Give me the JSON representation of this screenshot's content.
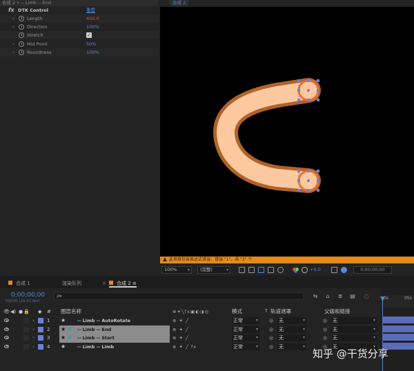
{
  "effects": {
    "header": "合成 2 • -- Limb -- End",
    "fx_label": "fx",
    "effect_name": "DTK Control",
    "reset": "重置",
    "params": [
      {
        "name": "Length",
        "value": "400.0",
        "expandable": true,
        "value_color": "#d84a3a"
      },
      {
        "name": "Direction",
        "value": "100%",
        "expandable": true,
        "value_color": "#4a8cdb"
      },
      {
        "name": "Stretch",
        "value": "✓",
        "expandable": false,
        "is_checkbox": true
      },
      {
        "name": "Mid Point",
        "value": "50%",
        "expandable": true,
        "value_color": "#4a8cdb"
      },
      {
        "name": "Roundness",
        "value": "100%",
        "expandable": true,
        "value_color": "#4a8cdb"
      }
    ]
  },
  "viewer": {
    "tab": "合成 2",
    "warning": "此项目包含表达式错误：错误 \"1\"，共 \"3\" 个",
    "zoom": "100%",
    "resolution": "(完整)",
    "exposure": "+0.0",
    "timecode": "0;00;00;00",
    "colors": {
      "limb_outer": "#b0622a",
      "limb_inner": "#fbc8a0",
      "handle_ring": "#e8742a",
      "handle_point": "#6f7fe0"
    }
  },
  "timeline": {
    "tabs": [
      {
        "label": "合成 1",
        "active": false,
        "closable": false
      },
      {
        "label": "渲染队列",
        "active": false,
        "closable": false
      },
      {
        "label": "合成 2",
        "active": true,
        "closable": true
      }
    ],
    "timecode": "0;00;00;00",
    "fps": "00000 (29.97 fps)",
    "search_placeholder": "ρ▸",
    "columns": {
      "name": "图层名称",
      "mode": "模式",
      "t": "T",
      "track_matte": "轨道遮罩",
      "parent": "父级和链接"
    },
    "layers": [
      {
        "num": "1",
        "name": "-- Limb -- AutoRotate",
        "selected": false,
        "mode": "正常",
        "track": "无",
        "parent": "无",
        "has_fx": false
      },
      {
        "num": "2",
        "name": "-- Limb -- End",
        "selected": true,
        "mode": "正常",
        "track": "无",
        "parent": "无",
        "has_fx": false
      },
      {
        "num": "3",
        "name": "-- Limb -- Start",
        "selected": true,
        "mode": "正常",
        "track": "无",
        "parent": "无",
        "has_fx": false
      },
      {
        "num": "4",
        "name": "-- Limb -- Limb",
        "selected": false,
        "mode": "正常",
        "track": "无",
        "parent": "无",
        "has_fx": true
      }
    ],
    "ruler": {
      "start": "0s",
      "end": "05s"
    }
  },
  "watermark": "知乎 @干货分享"
}
